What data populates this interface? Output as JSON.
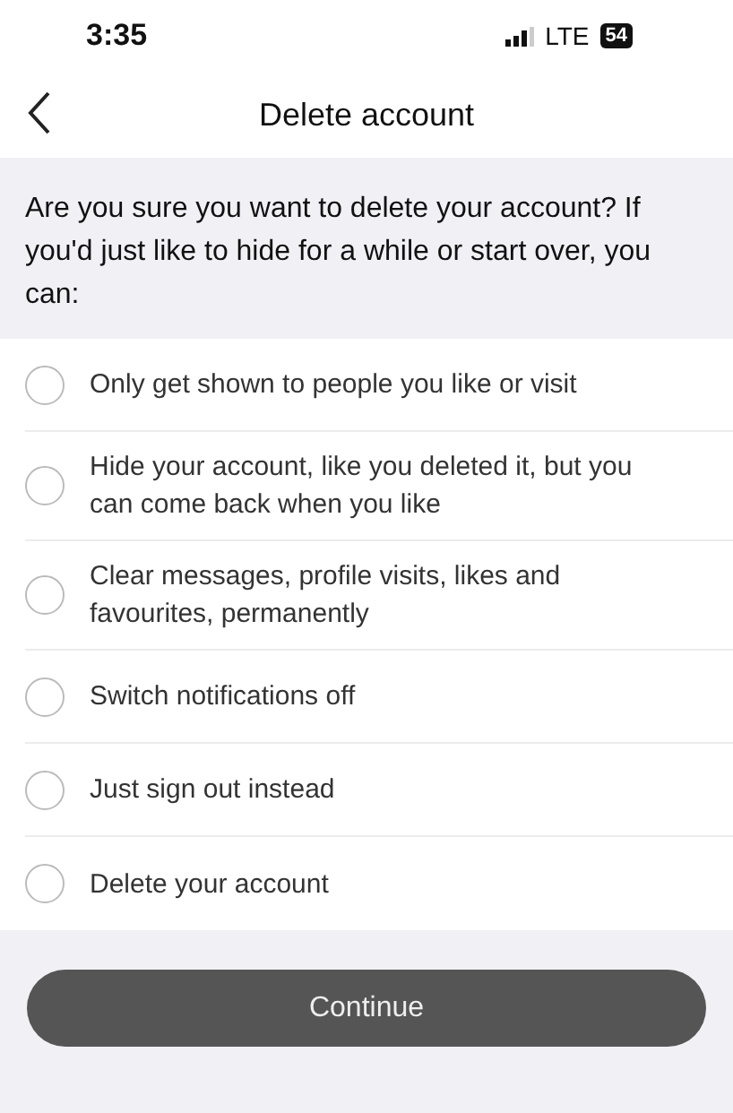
{
  "status_bar": {
    "time": "3:35",
    "network": "LTE",
    "battery": "54"
  },
  "nav": {
    "title": "Delete account"
  },
  "intro": "Are you sure you want to delete your account? If you'd just like to hide for a while or start over, you can:",
  "options": [
    {
      "label": "Only get shown to people you like or visit",
      "selected": false
    },
    {
      "label": "Hide your account, like you deleted it, but you can come back when you like",
      "selected": false
    },
    {
      "label": "Clear messages, profile visits, likes and favourites, permanently",
      "selected": false
    },
    {
      "label": "Switch notifications off",
      "selected": false
    },
    {
      "label": "Just sign out instead",
      "selected": false
    },
    {
      "label": "Delete your account",
      "selected": false
    }
  ],
  "button": {
    "label": "Continue",
    "disabled": true
  }
}
